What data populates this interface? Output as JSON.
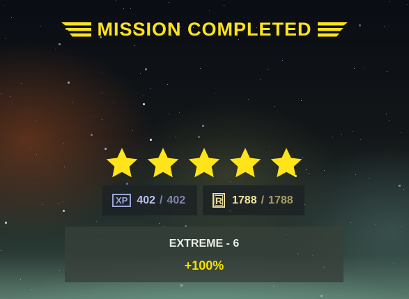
{
  "header": {
    "title": "MISSION COMPLETED"
  },
  "rating": {
    "stars_earned": 5,
    "stars_total": 5,
    "star_color": "#ffe41a"
  },
  "rewards": {
    "xp": {
      "badge": "XP",
      "current": "402",
      "separator": "/",
      "max": "402"
    },
    "requisition": {
      "badge": "R",
      "current": "1788",
      "separator": "/",
      "max": "1788"
    }
  },
  "difficulty": {
    "name": "EXTREME - 6",
    "bonus": "+100%",
    "bonus_color": "#f4e000"
  },
  "colors": {
    "accent": "#ffe41a",
    "xp": "#b9c2ec",
    "requisition": "#f2e79a"
  }
}
